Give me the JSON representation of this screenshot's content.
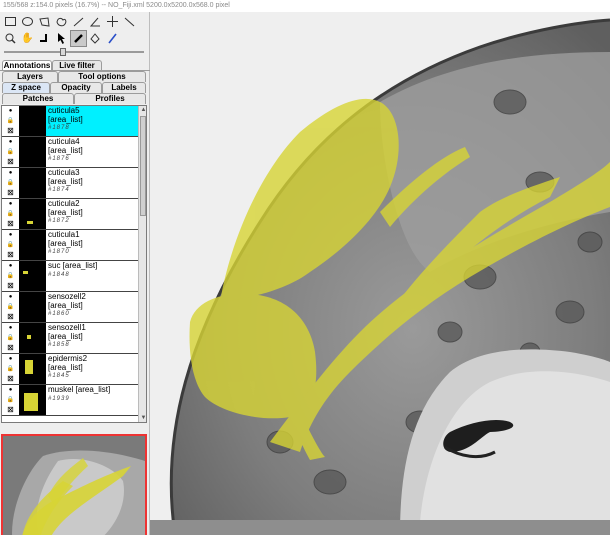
{
  "window": {
    "title": "155/568  z:154.0 pixels  (16.7%) -- NO_Fiji.xml  5200.0x5200.0x568.0 pixel"
  },
  "toolbar": {
    "row1_icons": [
      "rectangle-select-icon",
      "oval-select-icon",
      "polygon-select-icon",
      "freehand-select-icon",
      "line-icon",
      "angle-icon",
      "point-icon",
      "wand-icon"
    ],
    "row2_icons": [
      "zoom-icon",
      "hand-pan-icon",
      "align-icon",
      "arrow-select-icon",
      "pen-icon",
      "fill-icon",
      "brush-icon"
    ],
    "active_tool": "pen-icon"
  },
  "tabs": {
    "top": [
      "Annotations",
      "Live filter"
    ],
    "row2": [
      "Layers",
      "Tool options"
    ],
    "row3": [
      "Z space",
      "Opacity",
      "Labels"
    ],
    "row4": [
      "Patches",
      "Profiles"
    ],
    "selected": "Z space"
  },
  "layers": [
    {
      "name": "cuticula5",
      "type": "[area_list]",
      "id": "#1878",
      "selected": true
    },
    {
      "name": "cuticula4",
      "type": "[area_list]",
      "id": "#1876",
      "selected": false
    },
    {
      "name": "cuticula3",
      "type": "[area_list]",
      "id": "#1874",
      "selected": false
    },
    {
      "name": "cuticula2",
      "type": "[area_list]",
      "id": "#1872",
      "selected": false
    },
    {
      "name": "cuticula1",
      "type": "[area_list]",
      "id": "#1870",
      "selected": false
    },
    {
      "name": "suc [area_list]",
      "type": "",
      "id": "#1848",
      "selected": false
    },
    {
      "name": "sensozell2",
      "type": "[area_list]",
      "id": "#1860",
      "selected": false
    },
    {
      "name": "sensozell1",
      "type": "[area_list]",
      "id": "#1858",
      "selected": false
    },
    {
      "name": "epidermis2",
      "type": "[area_list]",
      "id": "#1845",
      "selected": false
    },
    {
      "name": "muskel [area_list]",
      "type": "",
      "id": "#1939",
      "selected": false
    }
  ],
  "colors": {
    "selection": "#00f0ff",
    "annotation": "#d7d435",
    "navigator_frame": "#ee3333"
  }
}
